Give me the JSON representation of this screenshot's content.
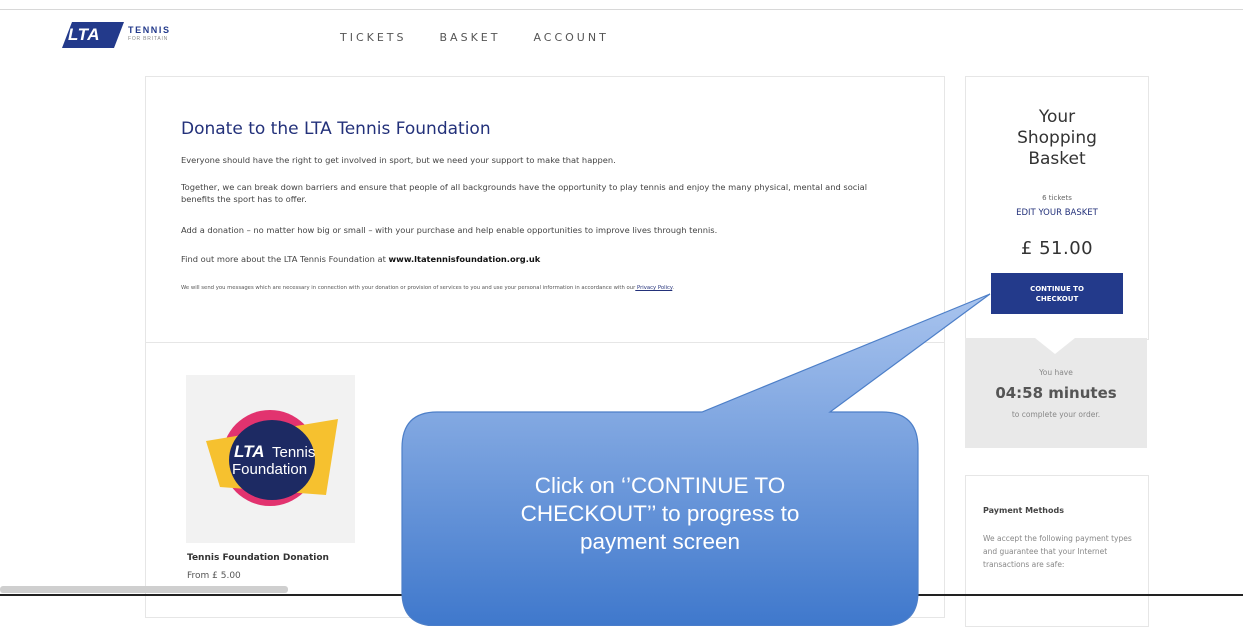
{
  "header": {
    "logo": {
      "mark_text": "LTA",
      "tennis": "TENNIS",
      "for_britain": "FOR BRITAIN"
    },
    "nav": [
      "TICKETS",
      "BASKET",
      "ACCOUNT"
    ]
  },
  "donate": {
    "title": "Donate to the LTA Tennis Foundation",
    "p1": "Everyone should have the right to get involved in sport, but we need your support to make that happen.",
    "p2": "Together, we can break down barriers and ensure that people of all backgrounds have the opportunity to play tennis and enjoy the many physical, mental and social benefits the sport has to offer.",
    "p3": "Add a donation – no matter how big or small – with your purchase and help enable opportunities to improve lives through tennis.",
    "p4_prefix": "Find out more about the LTA Tennis Foundation at ",
    "p4_link": "www.ltatennisfoundation.org.uk",
    "p5": "We will send you messages which are necessary in connection with your donation or provision of services to you and use your personal information in accordance with our",
    "privacy_link": " Privacy Policy",
    "p5_end": "."
  },
  "product": {
    "logo_line1": "LTA",
    "logo_line1b": "Tennis",
    "logo_line2": "Foundation",
    "title": "Tennis Foundation Donation",
    "price": "From £ 5.00"
  },
  "basket": {
    "title_line1": "Your",
    "title_line2": "Shopping",
    "title_line3": "Basket",
    "tickets": "6 tickets",
    "edit": "EDIT YOUR BASKET",
    "amount": "£ 51.00",
    "checkout_line1": "CONTINUE TO",
    "checkout_line2": "CHECKOUT"
  },
  "timer": {
    "you_have": "You have",
    "minutes": "04:58 minutes",
    "complete": "to complete your order."
  },
  "payment": {
    "title": "Payment Methods",
    "text": "We accept the following payment types and guarantee that your Internet transactions are safe:"
  },
  "callout": {
    "line1": "Click on ‘’CONTINUE TO",
    "line2": "CHECKOUT’’ to progress to",
    "line3": "payment screen",
    "fill_top": "#a9c4ee",
    "fill_bottom": "#3f78cc"
  }
}
